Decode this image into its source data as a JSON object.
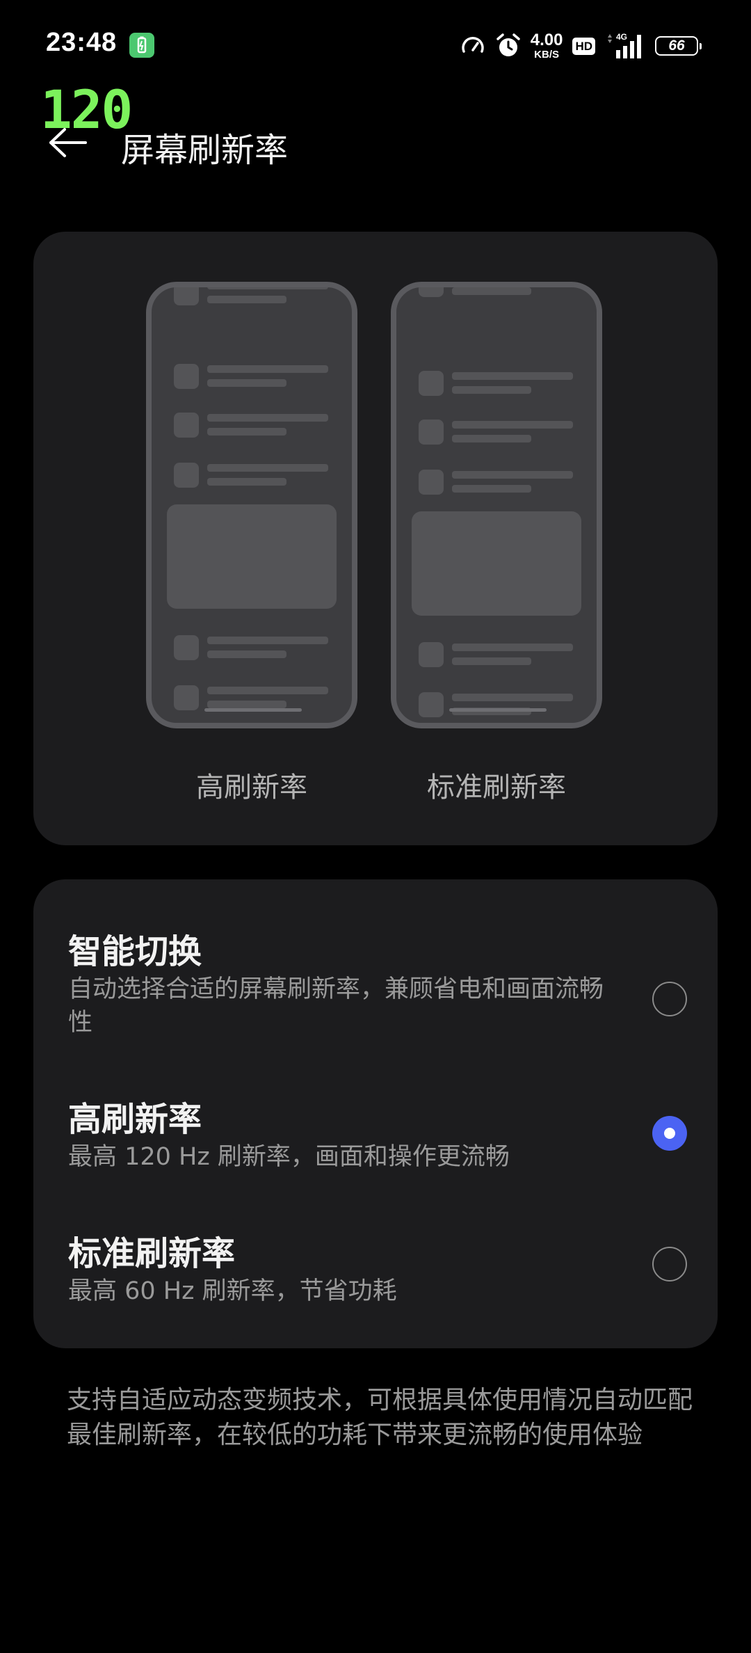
{
  "status_bar": {
    "time": "23:48",
    "net_speed_value": "4.00",
    "net_speed_unit": "KB/S",
    "hd_badge": "HD",
    "network_type": "4G",
    "battery_level": "66"
  },
  "fps_overlay": "120",
  "header": {
    "title": "屏幕刷新率"
  },
  "preview": {
    "high_label": "高刷新率",
    "standard_label": "标准刷新率"
  },
  "options": [
    {
      "title": "智能切换",
      "description": "自动选择合适的屏幕刷新率，兼顾省电和画面流畅性",
      "selected": false
    },
    {
      "title": "高刷新率",
      "description": "最高 120 Hz 刷新率，画面和操作更流畅",
      "selected": true
    },
    {
      "title": "标准刷新率",
      "description": "最高 60 Hz 刷新率，节省功耗",
      "selected": false
    }
  ],
  "footer": {
    "note": "支持自适应动态变频技术，可根据具体使用情况自动匹配最佳刷新率，在较低的功耗下带来更流畅的使用体验"
  },
  "colors": {
    "background": "#000000",
    "card": "#1c1c1e",
    "accent": "#4b63f3",
    "fps_overlay": "#7cf25c"
  }
}
